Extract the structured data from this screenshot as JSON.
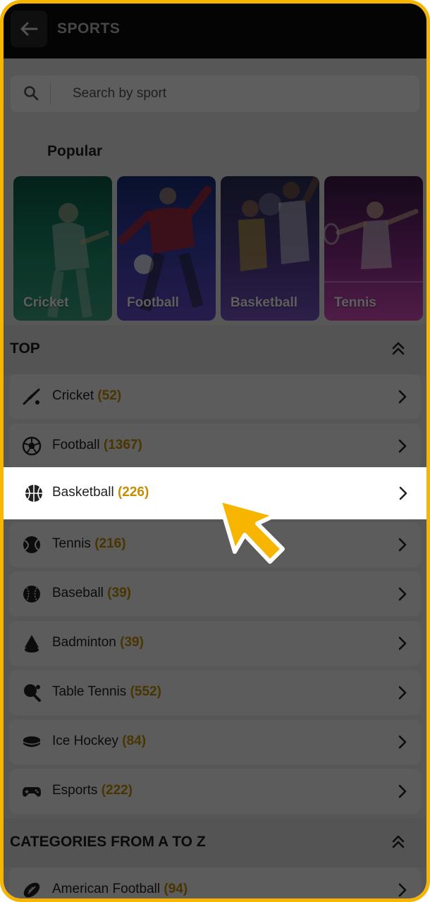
{
  "appbar": {
    "title": "SPORTS"
  },
  "search": {
    "placeholder": "Search by sport"
  },
  "popular": {
    "title": "Popular",
    "cards": [
      {
        "label": "Cricket"
      },
      {
        "label": "Football"
      },
      {
        "label": "Basketball"
      },
      {
        "label": "Tennis"
      }
    ]
  },
  "top": {
    "title": "TOP",
    "items": [
      {
        "name": "Cricket",
        "count": "(52)"
      },
      {
        "name": "Football",
        "count": "(1367)"
      },
      {
        "name": "Basketball",
        "count": "(226)"
      },
      {
        "name": "Tennis",
        "count": "(216)"
      },
      {
        "name": "Baseball",
        "count": "(39)"
      },
      {
        "name": "Badminton",
        "count": "(39)"
      },
      {
        "name": "Table Tennis",
        "count": "(552)"
      },
      {
        "name": "Ice Hockey",
        "count": "(84)"
      },
      {
        "name": "Esports",
        "count": "(222)"
      }
    ]
  },
  "categories": {
    "title": "CATEGORIES FROM A TO Z",
    "items": [
      {
        "name": "American Football",
        "count": "(94)"
      }
    ]
  },
  "colors": {
    "accent": "#f7b500",
    "count": "#c58f00"
  },
  "icons": {
    "back": "arrow-left-icon",
    "search": "search-icon",
    "collapse": "double-chevron-up-icon",
    "row": "chevron-right-icon",
    "pointer": "hand-pointer-arrow-icon"
  }
}
